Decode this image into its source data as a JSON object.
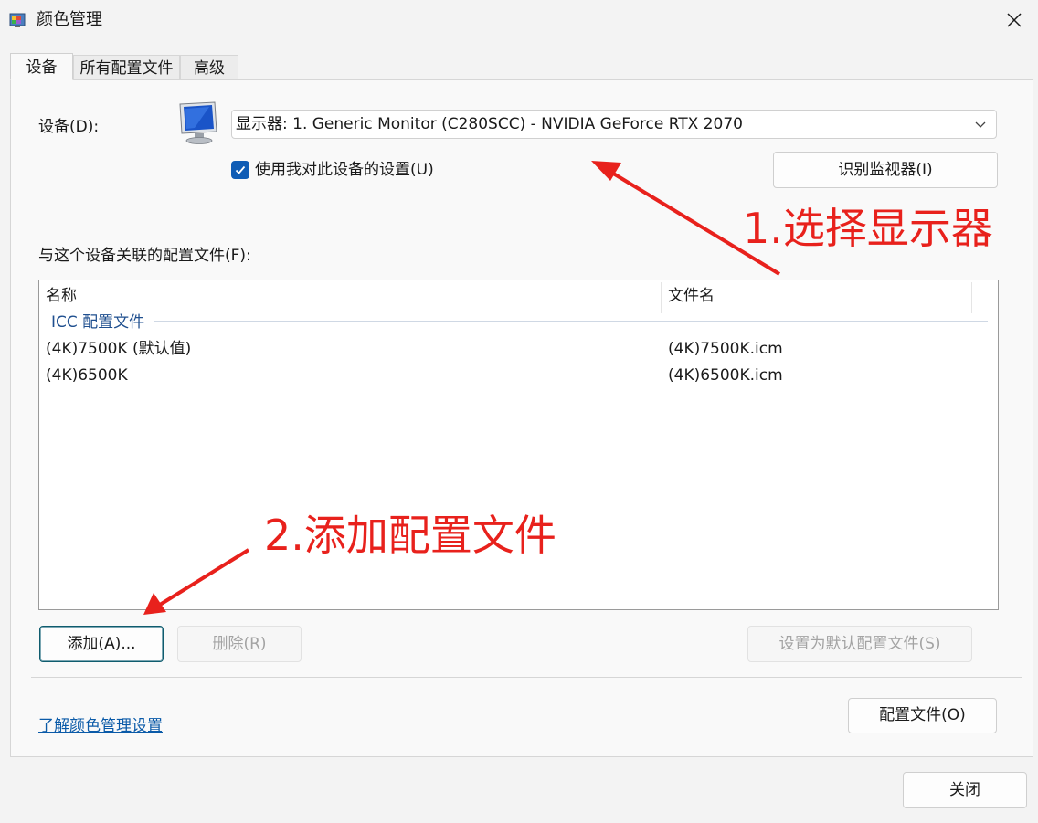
{
  "window": {
    "title": "颜色管理",
    "close_icon": "close-icon"
  },
  "tabs": [
    {
      "label": "设备",
      "active": true
    },
    {
      "label": "所有配置文件",
      "active": false
    },
    {
      "label": "高级",
      "active": false
    }
  ],
  "device": {
    "label": "设备(D):",
    "selected": "显示器: 1. Generic Monitor (C280SCC) - NVIDIA GeForce RTX 2070",
    "use_settings_label": "使用我对此设备的设置(U)",
    "use_settings_checked": true,
    "identify_button": "识别监视器(I)"
  },
  "profiles": {
    "label": "与这个设备关联的配置文件(F):",
    "columns": [
      "名称",
      "文件名"
    ],
    "group": "ICC 配置文件",
    "rows": [
      {
        "name": "(4K)7500K (默认值)",
        "file": "(4K)7500K.icm"
      },
      {
        "name": "(4K)6500K",
        "file": "(4K)6500K.icm"
      }
    ]
  },
  "buttons": {
    "add": "添加(A)...",
    "remove": "删除(R)",
    "set_default": "设置为默认配置文件(S)",
    "profile": "配置文件(O)",
    "close": "关闭"
  },
  "link": "了解颜色管理设置",
  "annotations": {
    "step1": "1.选择显示器",
    "step2": "2.添加配置文件",
    "color": "#e8211c"
  },
  "colors": {
    "accent": "#0f5cb5",
    "link": "#0a5aa8"
  }
}
